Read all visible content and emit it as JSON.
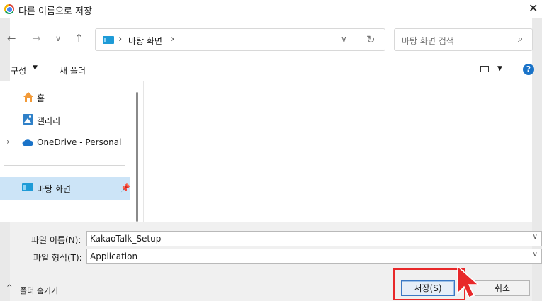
{
  "window": {
    "title": "다른 이름으로 저장"
  },
  "nav": {
    "address_path": "바탕 화면",
    "search_placeholder": "바탕 화면 검색"
  },
  "toolbar": {
    "organize_label": "구성",
    "new_folder_label": "새 폴더"
  },
  "sidebar": {
    "items": [
      {
        "label": "홈",
        "icon": "home-icon"
      },
      {
        "label": "갤러리",
        "icon": "gallery-icon"
      },
      {
        "label": "OneDrive - Personal",
        "icon": "onedrive-icon"
      },
      {
        "label": "바탕 화면",
        "icon": "desktop-folder-icon",
        "selected": true,
        "pinned": true
      }
    ]
  },
  "fields": {
    "filename_label": "파일 이름(N):",
    "filename_value": "KakaoTalk_Setup",
    "filetype_label": "파일 형식(T):",
    "filetype_value": "Application"
  },
  "footer": {
    "hide_folders_label": "폴더 숨기기",
    "save_label": "저장(S)",
    "cancel_label": "취소"
  },
  "colors": {
    "accent": "#1e9bd7",
    "highlight": "#e8282a",
    "selected_bg": "#cce4f7"
  }
}
